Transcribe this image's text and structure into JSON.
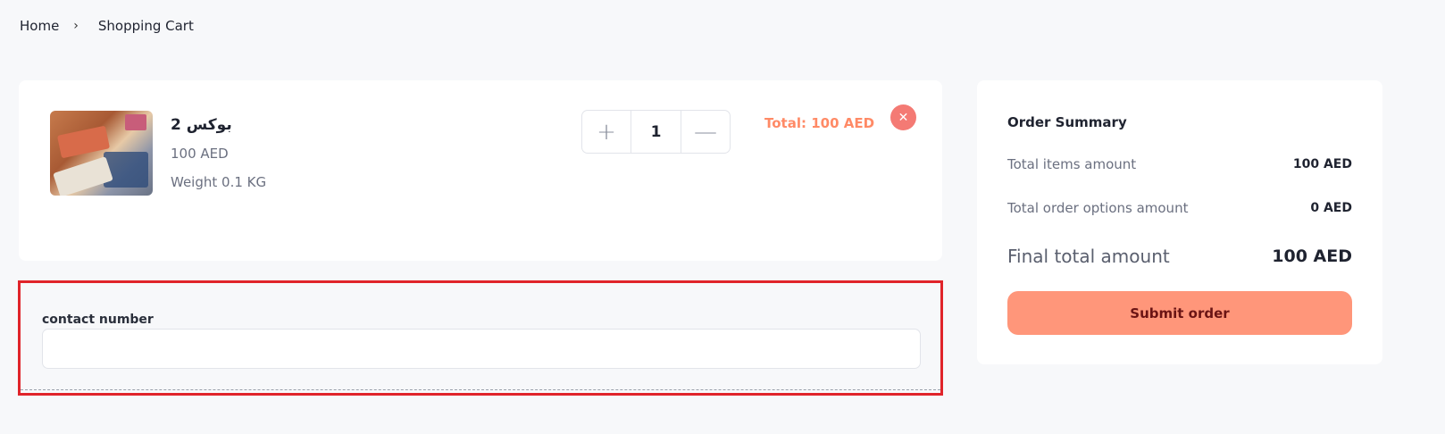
{
  "breadcrumb": {
    "home": "Home",
    "separator": "›",
    "current": "Shopping Cart"
  },
  "cart_item": {
    "name": "بوكس 2",
    "price": "100 AED",
    "weight": "Weight 0.1 KG",
    "quantity": "1",
    "plus_symbol": "+",
    "minus_symbol": "—",
    "line_total": "Total: 100 AED",
    "remove_symbol": "✕"
  },
  "contact": {
    "label": "contact number",
    "value": "",
    "placeholder": ""
  },
  "summary": {
    "title": "Order Summary",
    "items_label": "Total items amount",
    "items_value": "100 AED",
    "options_label": "Total order options amount",
    "options_value": "0 AED",
    "final_label": "Final total amount",
    "final_value": "100 AED",
    "submit_label": "Submit order"
  },
  "colors": {
    "accent": "#ff967a",
    "total_text": "#ff8a66",
    "remove": "#f47a74",
    "highlight_border": "#e0242a"
  }
}
